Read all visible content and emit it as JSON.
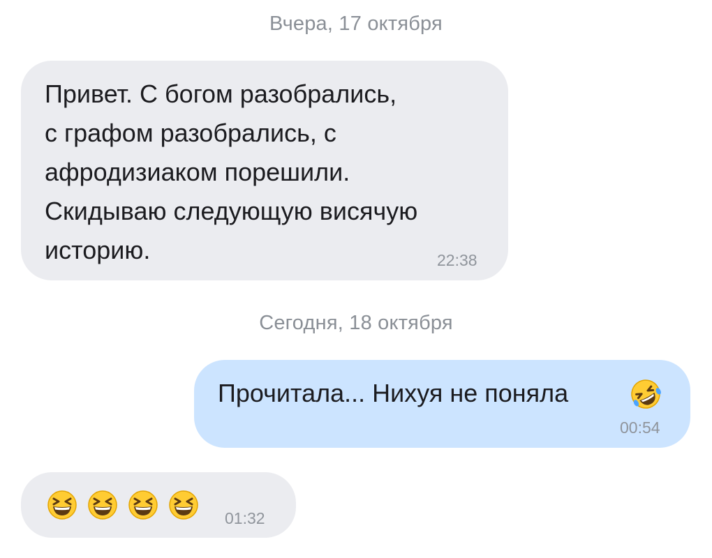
{
  "chat": {
    "separator_yesterday": "Вчера, 17 октября",
    "separator_today": "Сегодня, 18 октября",
    "messages": [
      {
        "direction": "incoming",
        "text": "Привет. С богом разобрались,\nс графом разобрались, с\nафродизиаком порешили.\nСкидываю следующую висячую\nисторию.",
        "time": "22:38"
      },
      {
        "direction": "outgoing",
        "text": "Прочитала... Нихуя не поняла",
        "emoji": "rolling-on-floor-laughing-emoji",
        "time": "00:54"
      },
      {
        "direction": "incoming",
        "emojis": [
          "grinning-squinting-face-emoji",
          "grinning-squinting-face-emoji",
          "grinning-squinting-face-emoji",
          "grinning-squinting-face-emoji"
        ],
        "time": "01:32"
      }
    ]
  },
  "colors": {
    "incoming_bubble": "#ebecf0",
    "outgoing_bubble": "#cce4ff",
    "separator_text": "#8a8f96",
    "timestamp_text": "#8f949b"
  }
}
